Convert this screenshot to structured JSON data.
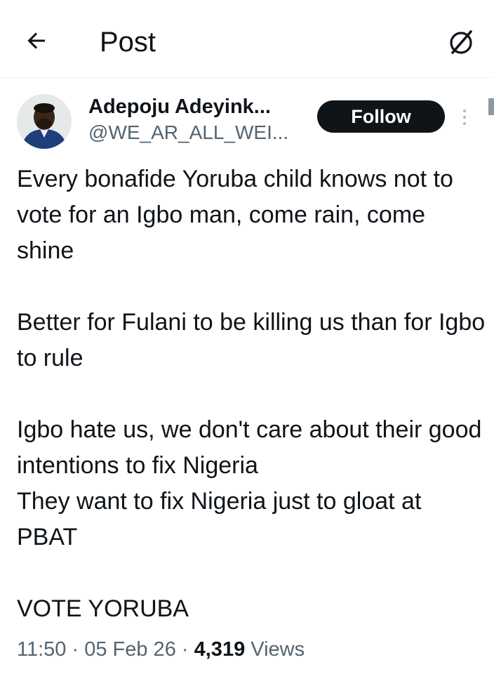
{
  "header": {
    "title": "Post",
    "back_icon": "arrow-left-icon",
    "grok_icon": "grok-icon"
  },
  "author": {
    "name": "Adepoju Adeyink...",
    "handle": "@WE_AR_ALL_WEI...",
    "follow_label": "Follow",
    "more_icon": "more-vertical-icon"
  },
  "tweet": {
    "paragraph1": "Every bonafide Yoruba child knows not to vote for an Igbo man, come rain, come shine",
    "paragraph2": "Better for Fulani to be killing us than for Igbo to rule",
    "paragraph3_line1": "Igbo hate us, we don't care about their good intentions to fix Nigeria",
    "paragraph3_line2": "They want to fix Nigeria just to gloat at PBAT",
    "paragraph4": "VOTE YORUBA"
  },
  "meta": {
    "time": "11:50",
    "separator": "·",
    "date": "05 Feb 26",
    "views_count": "4,319",
    "views_label": "Views"
  },
  "colors": {
    "text": "#0f1419",
    "secondary": "#536471",
    "follow_bg": "#0f1419",
    "follow_text": "#ffffff"
  }
}
